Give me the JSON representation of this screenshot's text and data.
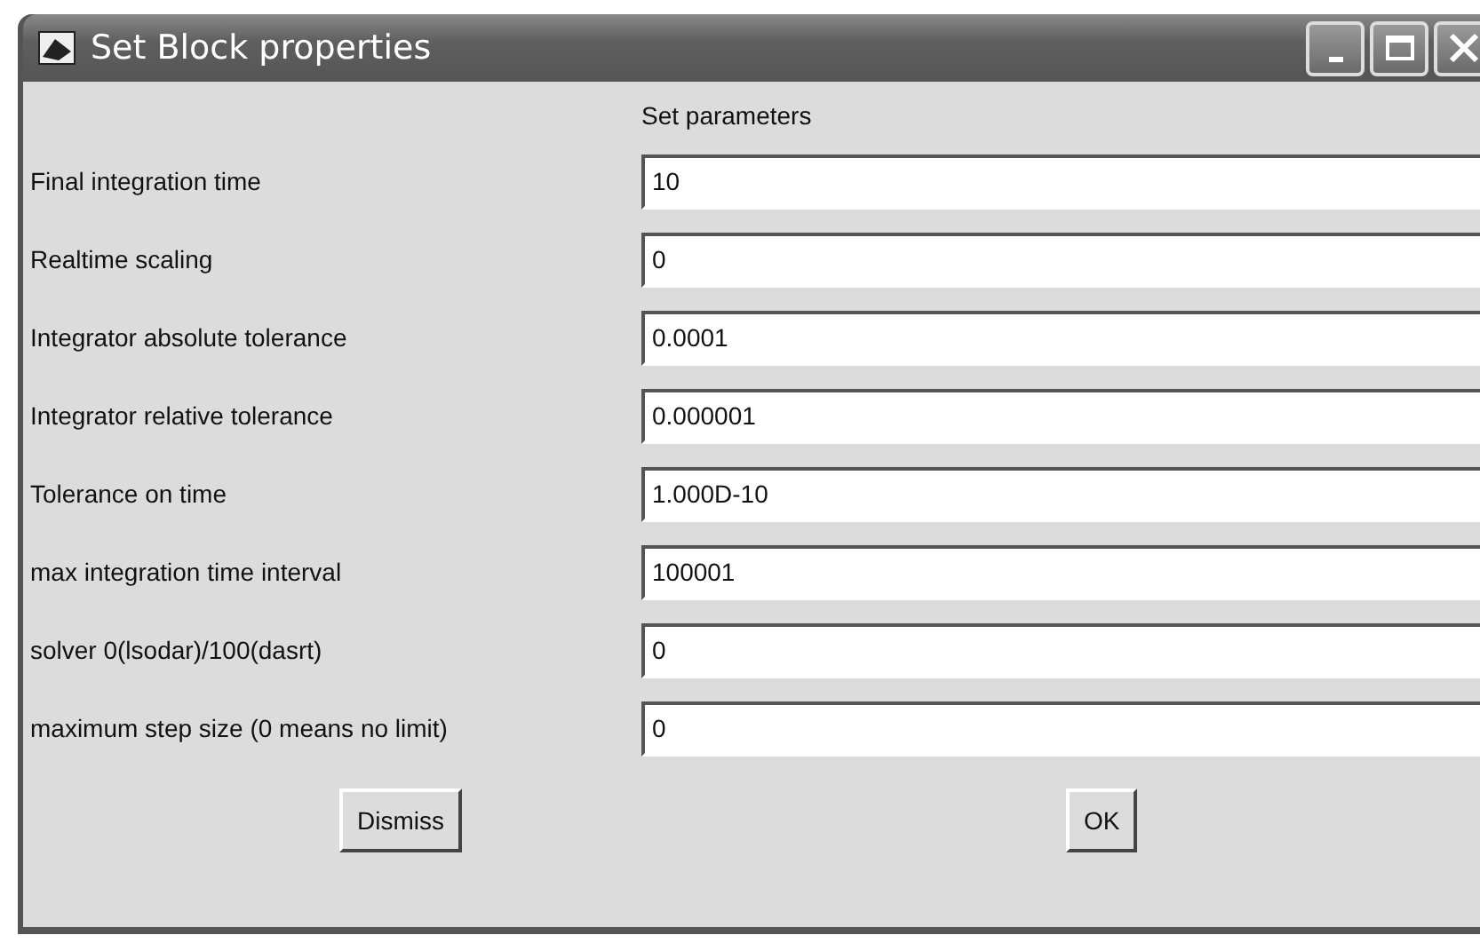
{
  "window": {
    "title": "Set Block properties"
  },
  "header": "Set parameters",
  "parameters": [
    {
      "label": "Final integration time",
      "value": "10"
    },
    {
      "label": "Realtime scaling",
      "value": "0"
    },
    {
      "label": "Integrator absolute tolerance",
      "value": "0.0001"
    },
    {
      "label": "Integrator relative tolerance",
      "value": "0.000001"
    },
    {
      "label": "Tolerance on time",
      "value": "1.000D-10"
    },
    {
      "label": "max integration time interval",
      "value": "100001"
    },
    {
      "label": "solver 0(lsodar)/100(dasrt)",
      "value": "0"
    },
    {
      "label": "maximum step size (0 means no limit)",
      "value": "0"
    }
  ],
  "buttons": [
    "Dismiss",
    "OK"
  ]
}
